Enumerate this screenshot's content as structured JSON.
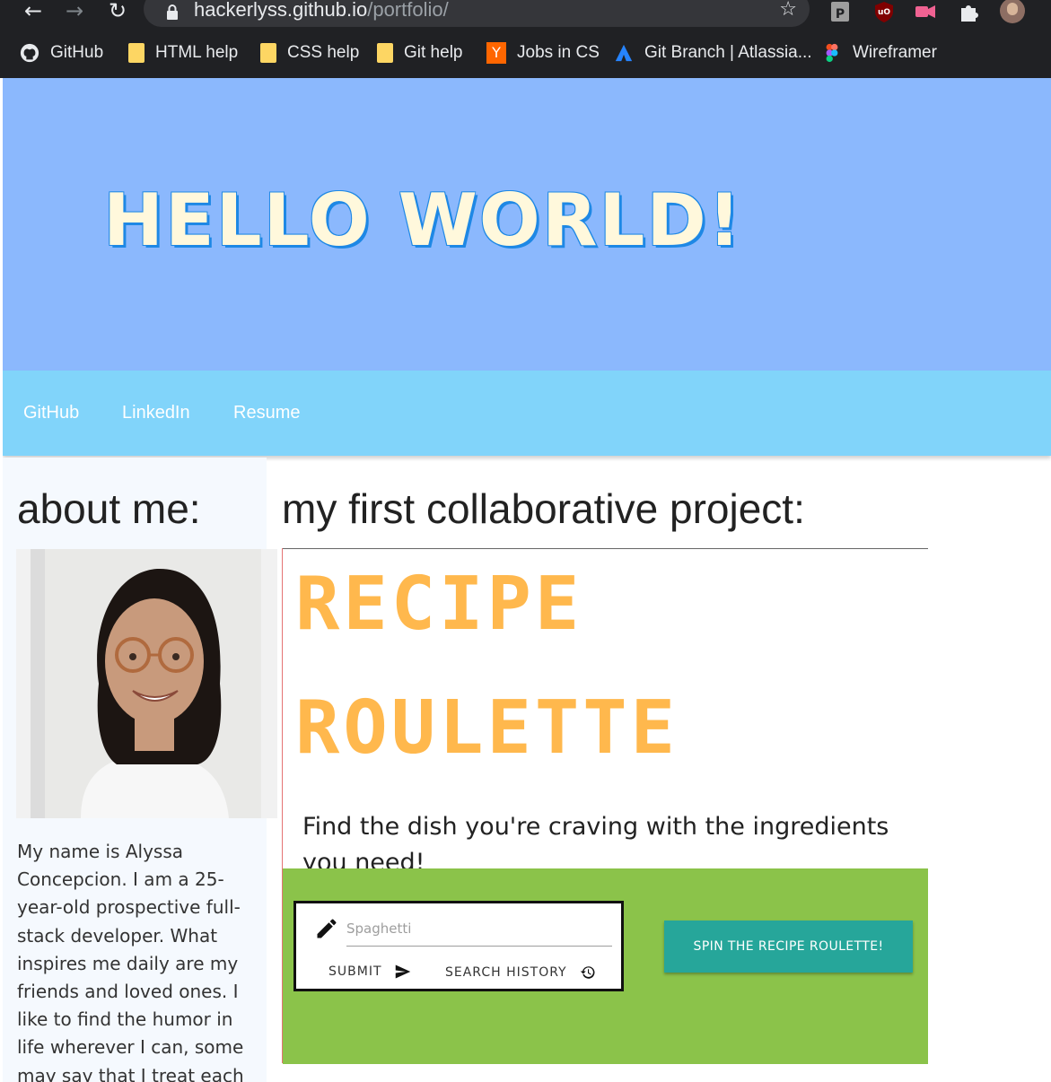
{
  "browser": {
    "url_host": "hackerlyss.github.io",
    "url_path": "/portfolio/",
    "bookmarks": [
      {
        "label": "GitHub",
        "icon": "github-icon"
      },
      {
        "label": "HTML help",
        "icon": "folder-icon"
      },
      {
        "label": "CSS help",
        "icon": "folder-icon"
      },
      {
        "label": "Git help",
        "icon": "folder-icon"
      },
      {
        "label": "Jobs in CS",
        "icon": "ycombinator-icon",
        "badge": "Y"
      },
      {
        "label": "Git Branch | Atlassia...",
        "icon": "atlassian-icon"
      },
      {
        "label": "Wireframer",
        "icon": "figma-icon"
      }
    ],
    "extension_badge": "P",
    "accent_dark": "#202124"
  },
  "hero": {
    "title": "HELLO WORLD!",
    "background": "#8bb8fd"
  },
  "nav": {
    "links": [
      "GitHub",
      "LinkedIn",
      "Resume"
    ],
    "background": "#81d4fa"
  },
  "about": {
    "heading": "about me:",
    "photo_alt": "portrait-photo",
    "bio": "My name is Alyssa Concepcion. I am a 25-year-old prospective full-stack developer. What inspires me daily are my friends and loved ones. I like to find the humor in life wherever I can, some may say that I treat each interaction like a round"
  },
  "project": {
    "heading": "my first collaborative project:",
    "title_line1": "RECIPE",
    "title_line2": "ROULETTE",
    "subtitle": "Find the dish you're craving with the ingredients you need!",
    "input_placeholder": "Spaghetti",
    "submit_label": "SUBMIT",
    "history_label": "SEARCH HISTORY",
    "spin_label": "SPIN THE RECIPE ROULETTE!",
    "title_color": "#ffb84d",
    "panel_color": "#8bc34a",
    "button_color": "#26a69a"
  }
}
